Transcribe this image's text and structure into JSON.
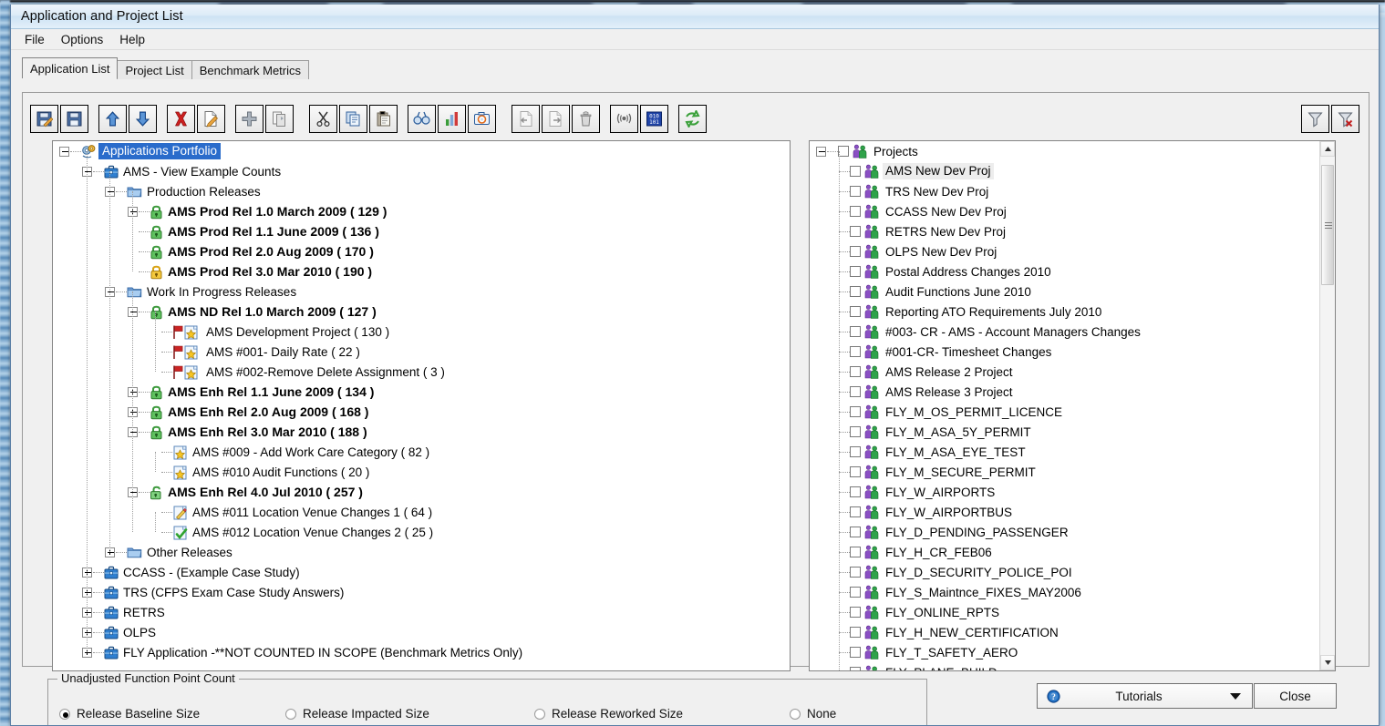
{
  "window": {
    "title": "Application and Project List"
  },
  "menu": {
    "items": [
      {
        "label": "File"
      },
      {
        "label": "Options"
      },
      {
        "label": "Help"
      }
    ]
  },
  "tabs": [
    {
      "label": "Application List",
      "active": true
    },
    {
      "label": "Project List",
      "active": false
    },
    {
      "label": "Benchmark Metrics",
      "active": false
    }
  ],
  "toolbar": {
    "buttons": [
      {
        "name": "save-as-icon",
        "tooltip": "Save As"
      },
      {
        "name": "save-icon",
        "tooltip": "Save"
      },
      {
        "name": "move-up-icon",
        "tooltip": "Move Up"
      },
      {
        "name": "move-down-icon",
        "tooltip": "Move Down"
      },
      {
        "name": "delete-icon",
        "tooltip": "Delete"
      },
      {
        "name": "edit-icon",
        "tooltip": "Edit"
      },
      {
        "name": "add-icon",
        "tooltip": "Add"
      },
      {
        "name": "duplicate-icon",
        "tooltip": "Duplicate"
      },
      {
        "name": "cut-icon",
        "tooltip": "Cut"
      },
      {
        "name": "copy-icon",
        "tooltip": "Copy"
      },
      {
        "name": "paste-icon",
        "tooltip": "Paste"
      },
      {
        "name": "find-icon",
        "tooltip": "Find"
      },
      {
        "name": "chart-icon",
        "tooltip": "Charts"
      },
      {
        "name": "camera-icon",
        "tooltip": "Snapshot"
      },
      {
        "name": "import-icon",
        "tooltip": "Import"
      },
      {
        "name": "export-icon",
        "tooltip": "Export"
      },
      {
        "name": "trash-icon",
        "tooltip": "Purge"
      },
      {
        "name": "broadcast-icon",
        "tooltip": "Publish"
      },
      {
        "name": "binary-icon",
        "tooltip": "Raw Data"
      },
      {
        "name": "refresh-icon",
        "tooltip": "Refresh"
      },
      {
        "name": "filter-icon",
        "tooltip": "Filter"
      },
      {
        "name": "clear-filter-icon",
        "tooltip": "Clear Filter"
      }
    ]
  },
  "application_tree": {
    "root": {
      "label": "Applications Portfolio",
      "icon": "gears-icon",
      "selected": true,
      "expander": "minus"
    },
    "nodes": [
      {
        "depth": 1,
        "label": "AMS -  View  Example Counts",
        "icon": "briefcase-icon",
        "expander": "minus",
        "bold": false
      },
      {
        "depth": 2,
        "label": "Production Releases",
        "icon": "folder-icon",
        "expander": "minus",
        "bold": false
      },
      {
        "depth": 3,
        "label": "AMS Prod  Rel 1.0 March 2009 ( 129 )",
        "icon": "lock-green-icon",
        "expander": "plus",
        "bold": true
      },
      {
        "depth": 3,
        "label": "AMS Prod  Rel 1.1 June 2009 ( 136 )",
        "icon": "lock-green-icon",
        "expander": "leaf",
        "bold": true
      },
      {
        "depth": 3,
        "label": " AMS Prod Rel 2.0 Aug 2009 ( 170 )",
        "icon": "lock-green-icon",
        "expander": "leaf",
        "bold": true
      },
      {
        "depth": 3,
        "label": "AMS Prod Rel 3.0 Mar 2010 ( 190 )",
        "icon": "lock-yellow-icon",
        "expander": "leaf",
        "bold": true
      },
      {
        "depth": 2,
        "label": "Work In Progress Releases",
        "icon": "folder-icon",
        "expander": "minus",
        "bold": false
      },
      {
        "depth": 3,
        "label": "AMS ND Rel 1.0 March 2009 ( 127 )",
        "icon": "lock-green-icon",
        "expander": "minus",
        "bold": true
      },
      {
        "depth": 4,
        "label": "AMS Development Project ( 130 )",
        "icon": "flag-star-icon",
        "expander": "leaf",
        "bold": false
      },
      {
        "depth": 4,
        "label": "AMS #001- Daily Rate ( 22 )",
        "icon": "flag-star-icon",
        "expander": "leaf",
        "bold": false
      },
      {
        "depth": 4,
        "label": "AMS #002-Remove Delete Assignment ( 3 )",
        "icon": "flag-star-icon",
        "expander": "leaf",
        "bold": false
      },
      {
        "depth": 3,
        "label": "AMS Enh Rel 1.1 June 2009 ( 134 )",
        "icon": "lock-green-icon",
        "expander": "plus",
        "bold": true
      },
      {
        "depth": 3,
        "label": "AMS Enh Rel 2.0 Aug 2009 ( 168 )",
        "icon": "lock-green-icon",
        "expander": "plus",
        "bold": true
      },
      {
        "depth": 3,
        "label": "AMS Enh Rel 3.0 Mar 2010 ( 188 )",
        "icon": "lock-green-icon",
        "expander": "minus",
        "bold": true
      },
      {
        "depth": 4,
        "label": "AMS #009 - Add Work Care Category ( 82 )",
        "icon": "star-doc-icon",
        "expander": "leaf",
        "bold": false
      },
      {
        "depth": 4,
        "label": "AMS #010 Audit Functions ( 20 )",
        "icon": "star-doc-icon",
        "expander": "leaf",
        "bold": false
      },
      {
        "depth": 3,
        "label": "AMS Enh Rel 4.0 Jul 2010 ( 257 )",
        "icon": "lock-open-green-icon",
        "expander": "minus",
        "bold": true
      },
      {
        "depth": 4,
        "label": "AMS #011 Location Venue Changes 1 ( 64 )",
        "icon": "pencil-doc-icon",
        "expander": "leaf",
        "bold": false
      },
      {
        "depth": 4,
        "label": "AMS #012 Location Venue Changes 2 ( 25 )",
        "icon": "check-doc-icon",
        "expander": "leaf",
        "bold": false
      },
      {
        "depth": 2,
        "label": "Other Releases",
        "icon": "folder-icon",
        "expander": "plus",
        "bold": false
      },
      {
        "depth": 1,
        "label": "CCASS - (Example Case Study)",
        "icon": "briefcase-icon",
        "expander": "plus",
        "bold": false
      },
      {
        "depth": 1,
        "label": " TRS  (CFPS Exam Case Study Answers)",
        "icon": "briefcase-icon",
        "expander": "plus",
        "bold": false
      },
      {
        "depth": 1,
        "label": "RETRS",
        "icon": "briefcase-icon",
        "expander": "plus",
        "bold": false
      },
      {
        "depth": 1,
        "label": "OLPS",
        "icon": "briefcase-icon",
        "expander": "plus",
        "bold": false
      },
      {
        "depth": 1,
        "label": "FLY Application -**NOT COUNTED IN SCOPE (Benchmark Metrics Only)",
        "icon": "briefcase-icon",
        "expander": "plus",
        "bold": false
      }
    ]
  },
  "project_tree": {
    "root": {
      "label": "Projects",
      "icon": "people-icon",
      "expander": "minus",
      "checked": false
    },
    "items": [
      {
        "label": "AMS New Dev Proj",
        "checked": false,
        "highlighted": true
      },
      {
        "label": "TRS New Dev Proj",
        "checked": false
      },
      {
        "label": "CCASS New Dev Proj",
        "checked": false
      },
      {
        "label": "RETRS New Dev Proj",
        "checked": false
      },
      {
        "label": "OLPS New Dev Proj",
        "checked": false
      },
      {
        "label": "Postal Address Changes 2010",
        "checked": false
      },
      {
        "label": "Audit Functions June 2010",
        "checked": false
      },
      {
        "label": " Reporting ATO Requirements July 2010",
        "checked": false
      },
      {
        "label": "#003- CR - AMS - Account Managers Changes",
        "checked": false
      },
      {
        "label": "#001-CR- Timesheet Changes",
        "checked": false
      },
      {
        "label": "AMS Release 2 Project",
        "checked": false
      },
      {
        "label": "AMS Release 3 Project",
        "checked": false
      },
      {
        "label": "FLY_M_OS_PERMIT_LICENCE",
        "checked": false
      },
      {
        "label": "FLY_M_ASA_5Y_PERMIT",
        "checked": false
      },
      {
        "label": "FLY_M_ASA_EYE_TEST",
        "checked": false
      },
      {
        "label": "FLY_M_SECURE_PERMIT",
        "checked": false
      },
      {
        "label": "FLY_W_AIRPORTS",
        "checked": false
      },
      {
        "label": "FLY_W_AIRPORTBUS",
        "checked": false
      },
      {
        "label": "FLY_D_PENDING_PASSENGER",
        "checked": false
      },
      {
        "label": "FLY_H_CR_FEB06",
        "checked": false
      },
      {
        "label": "FLY_D_SECURITY_POLICE_POI",
        "checked": false
      },
      {
        "label": "FLY_S_Maintnce_FIXES_MAY2006",
        "checked": false
      },
      {
        "label": "FLY_ONLINE_RPTS",
        "checked": false
      },
      {
        "label": "FLY_H_NEW_CERTIFICATION",
        "checked": false
      },
      {
        "label": "FLY_T_SAFETY_AERO",
        "checked": false
      },
      {
        "label": "FLY_PLANE_BUILD",
        "checked": false
      }
    ]
  },
  "ufp_group": {
    "legend": "Unadjusted Function Point Count",
    "options": [
      {
        "label": "Release Baseline Size",
        "selected": true
      },
      {
        "label": "Release Impacted Size",
        "selected": false
      },
      {
        "label": "Release Reworked Size",
        "selected": false
      },
      {
        "label": "None",
        "selected": false
      }
    ]
  },
  "footer": {
    "tutorials_label": "Tutorials",
    "close_label": "Close"
  },
  "colors": {
    "selection_blue": "#2a6ccb",
    "title_bar": "#cde2f3",
    "panel_bg": "#f0f0f0",
    "tree_bg": "#ffffff"
  }
}
